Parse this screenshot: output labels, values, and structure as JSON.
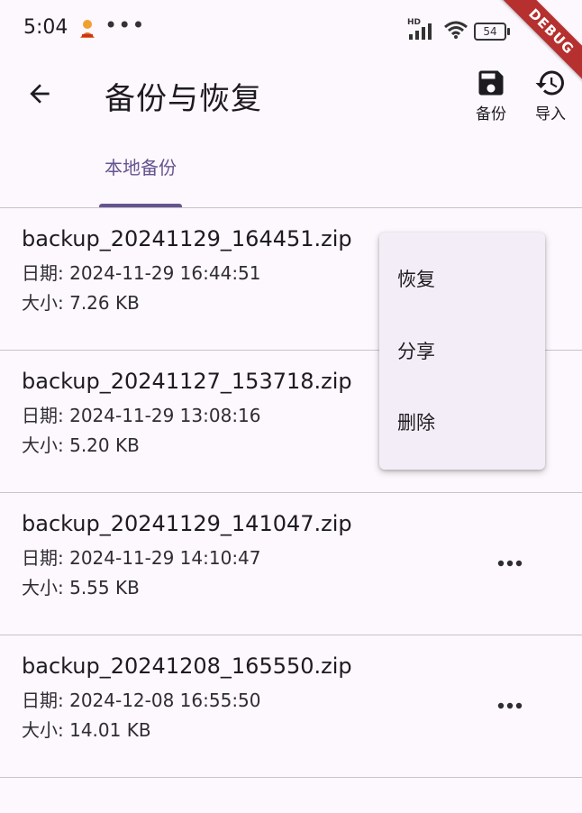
{
  "status_bar": {
    "time": "5:04",
    "overflow": "•••",
    "battery": "54",
    "hd_label": "HD",
    "signal_icon": "signal-icon",
    "wifi_icon": "wifi-icon"
  },
  "debug_banner": "DEBUG",
  "app_bar": {
    "title": "备份与恢复",
    "back_icon": "arrow-back-icon",
    "actions": [
      {
        "label": "备份",
        "icon": "save-icon"
      },
      {
        "label": "导入",
        "icon": "history-icon"
      }
    ]
  },
  "tabs": [
    {
      "label": "本地备份",
      "selected": true
    }
  ],
  "backups": [
    {
      "name": "backup_20241129_164451.zip",
      "date": "日期: 2024-11-29 16:44:51",
      "size": "大小: 7.26 KB"
    },
    {
      "name": "backup_20241127_153718.zip",
      "date": "日期: 2024-11-29 13:08:16",
      "size": "大小: 5.20 KB"
    },
    {
      "name": "backup_20241129_141047.zip",
      "date": "日期: 2024-11-29 14:10:47",
      "size": "大小: 5.55 KB"
    },
    {
      "name": "backup_20241208_165550.zip",
      "date": "日期: 2024-12-08 16:55:50",
      "size": "大小: 14.01 KB"
    }
  ],
  "popup_menu": {
    "items": [
      {
        "label": "恢复"
      },
      {
        "label": "分享"
      },
      {
        "label": "删除"
      }
    ]
  },
  "colors": {
    "background": "#fdf7fe",
    "primary": "#65558f",
    "menu_bg": "#f3edf7",
    "divider": "#c8c3cc",
    "debug": "#b5302f"
  }
}
